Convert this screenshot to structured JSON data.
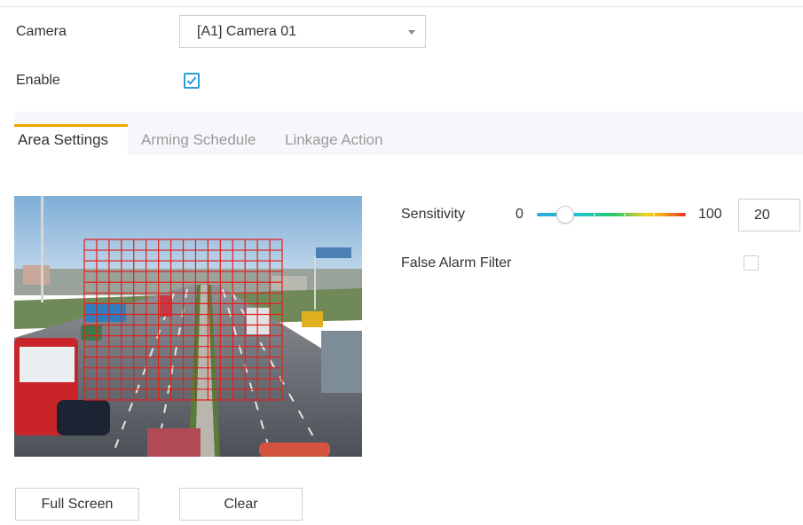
{
  "form": {
    "camera_label": "Camera",
    "camera_value": "[A1] Camera 01",
    "enable_label": "Enable",
    "enable_checked": true
  },
  "tabs": [
    {
      "label": "Area Settings",
      "active": true
    },
    {
      "label": "Arming Schedule",
      "active": false
    },
    {
      "label": "Linkage Action",
      "active": false
    }
  ],
  "sensitivity": {
    "label": "Sensitivity",
    "min_label": "0",
    "max_label": "100",
    "value": "20"
  },
  "false_alarm": {
    "label": "False Alarm Filter",
    "checked": false
  },
  "buttons": {
    "full_screen": "Full Screen",
    "clear": "Clear"
  },
  "colors": {
    "accent_tab": "#f4a200",
    "checkbox": "#2b9ed8",
    "grid": "#e0201e"
  }
}
